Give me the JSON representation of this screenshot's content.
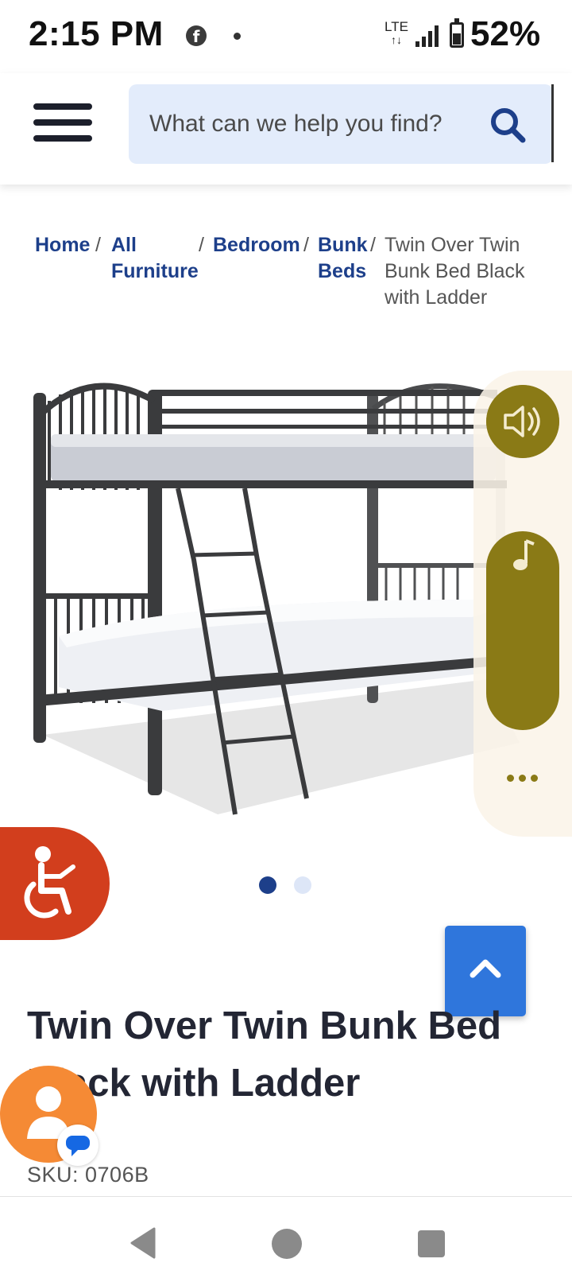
{
  "status_bar": {
    "time": "2:15 PM",
    "network": "LTE",
    "battery": "52%",
    "icons": [
      "facebook-icon",
      "notification-dot-icon",
      "lte-icon",
      "signal-icon",
      "battery-icon"
    ]
  },
  "header": {
    "menu_icon": "hamburger-menu-icon",
    "search_placeholder": "What can we help you find?",
    "search_icon": "search-icon"
  },
  "breadcrumb": {
    "items": [
      "Home",
      "All Furniture",
      "Bedroom",
      "Bunk Beds"
    ],
    "current": "Twin Over Twin Bunk Bed Black with Ladder",
    "separator": "/"
  },
  "gallery": {
    "image": "bunk-bed-product-photo",
    "slide_count": 2,
    "active_slide": 1
  },
  "media_panel": {
    "icons": [
      "speaker-icon",
      "music-note-icon",
      "more-dots-icon"
    ]
  },
  "floating": {
    "accessibility_icon": "wheelchair-icon",
    "back_to_top_icon": "chevron-up-icon",
    "chat_icon": "chat-agent-icon"
  },
  "product": {
    "title": "Twin Over Twin Bunk Bed Black with Ladder",
    "sku": "SKU: 0706B"
  },
  "nav_bar": {
    "icons": [
      "back-triangle-icon",
      "home-circle-icon",
      "recent-square-icon"
    ]
  },
  "colors": {
    "brand_blue": "#1d3f8a",
    "search_bg": "#e3ecfb",
    "accessibility_red": "#d23e1d",
    "back_to_top_blue": "#2f76dc",
    "chat_orange": "#f58a35",
    "media_olive": "#8a7a16"
  }
}
